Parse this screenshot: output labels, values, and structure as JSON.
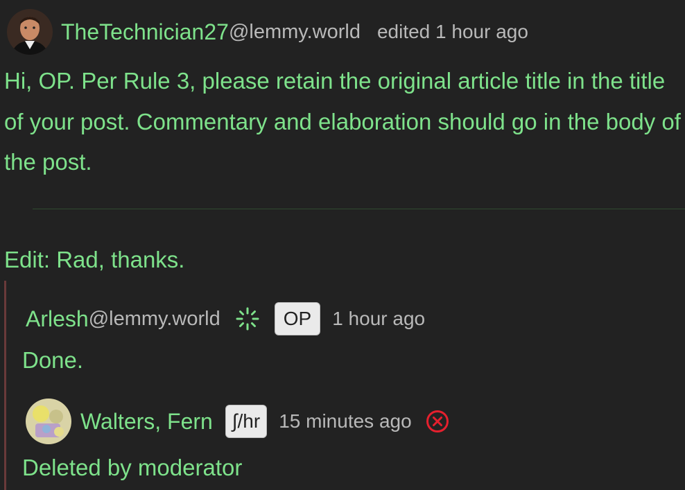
{
  "comment": {
    "author": {
      "username": "TheTechnician27",
      "instance": "@lemmy.world",
      "avatar_icon": "user-avatar"
    },
    "meta": "edited 1 hour ago",
    "body": "Hi, OP. Per Rule 3, please retain the original article title in the title of your post. Commentary and elaboration should go in the body of the post.",
    "edit_note": "Edit: Rad, thanks."
  },
  "replies": [
    {
      "username": "Arlesh",
      "instance": "@lemmy.world",
      "status_icon": "sparkle-icon",
      "badge": "OP",
      "time": "1 hour ago",
      "body": "Done."
    },
    {
      "username": "Walters, Fern",
      "badge": "∫/hr",
      "time": "15 minutes ago",
      "status_icon": "removed-x-icon",
      "body": "Deleted by moderator"
    }
  ],
  "colors": {
    "background": "#222222",
    "text_green": "#7ee28b",
    "muted": "#b9b9b9",
    "thread_bar": "#6a3a3a",
    "removed_red": "#e5202e"
  }
}
